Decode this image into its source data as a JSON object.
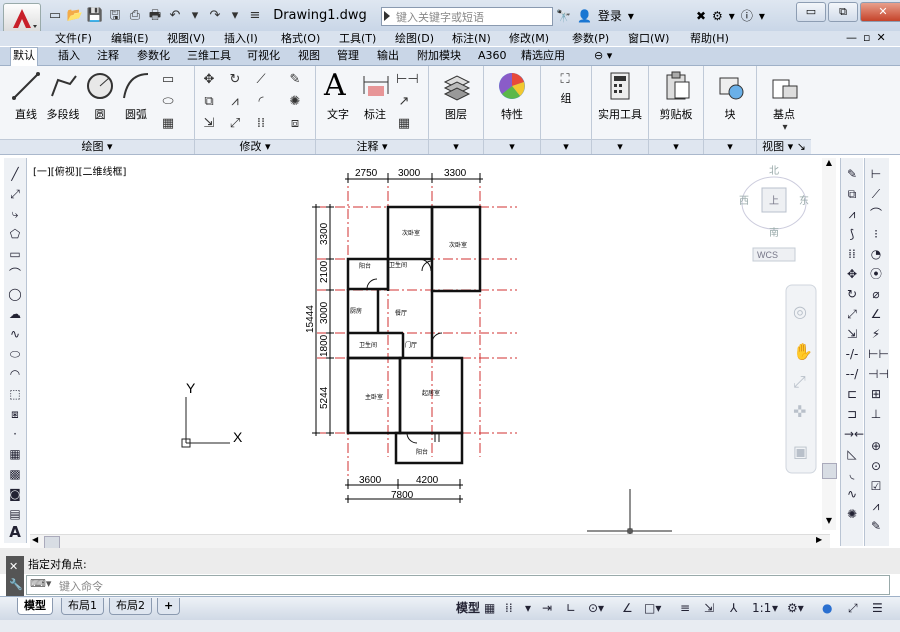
{
  "app": {
    "doc_title": "Drawing1.dwg"
  },
  "search": {
    "placeholder": "键入关键字或短语"
  },
  "account": {
    "login": "登录"
  },
  "window_buttons": {
    "minimize": "▭",
    "restore": "⧉",
    "close": "✕"
  },
  "menubar": {
    "items": [
      "文件(F)",
      "编辑(E)",
      "视图(V)",
      "插入(I)",
      "格式(O)",
      "工具(T)",
      "绘图(D)",
      "标注(N)",
      "修改(M)",
      "参数(P)",
      "窗口(W)",
      "帮助(H)"
    ],
    "mdi": [
      "—",
      "▫",
      "✕"
    ]
  },
  "ribbon_tabs": [
    "默认",
    "插入",
    "注释",
    "参数化",
    "三维工具",
    "可视化",
    "视图",
    "管理",
    "输出",
    "附加模块",
    "A360",
    "精选应用"
  ],
  "ribbon": {
    "draw": {
      "line": "直线",
      "polyline": "多段线",
      "circle": "圆",
      "arc": "圆弧",
      "footer": "绘图"
    },
    "modify": {
      "footer": "修改"
    },
    "annotation": {
      "text": "文字",
      "dimension": "标注",
      "footer": "注释"
    },
    "layers": {
      "label": "图层"
    },
    "properties": {
      "label": "特性"
    },
    "group": {
      "label": "组"
    },
    "utilities": {
      "label": "实用工具"
    },
    "clipboard": {
      "label": "剪贴板"
    },
    "block": {
      "label": "块"
    },
    "base": {
      "label": "基点"
    },
    "view": {
      "footer": "视图"
    }
  },
  "viewport": {
    "label": "[一][俯视][二维线框]"
  },
  "viewcube": {
    "north": "北",
    "south": "南",
    "east": "东",
    "west": "西",
    "top": "上",
    "wcs": "WCS"
  },
  "ucs": {
    "x": "X",
    "y": "Y"
  },
  "plan": {
    "dims_top": [
      "2750",
      "3000",
      "3300"
    ],
    "dims_left": [
      "3300",
      "2100",
      "3000",
      "1800",
      "5244"
    ],
    "dim_total_left": "15444",
    "dims_bottom": [
      "3600",
      "4200"
    ],
    "dim_total_bottom": "7800",
    "rooms": {
      "bedroom2": "次卧室",
      "bedroom3": "次卧室",
      "balcony_top": "阳台",
      "bath_top": "卫生间",
      "kitchen": "厨房",
      "dining": "餐厅",
      "bath_mid": "卫生间",
      "foyer": "门厅",
      "master": "主卧室",
      "living": "起居室",
      "balcony_bottom": "阳台"
    }
  },
  "command": {
    "history": "指定对角点:",
    "placeholder": "键入命令"
  },
  "layout_tabs": [
    "模型",
    "布局1",
    "布局2"
  ],
  "status": {
    "model": "模型",
    "scale": "1:1"
  }
}
